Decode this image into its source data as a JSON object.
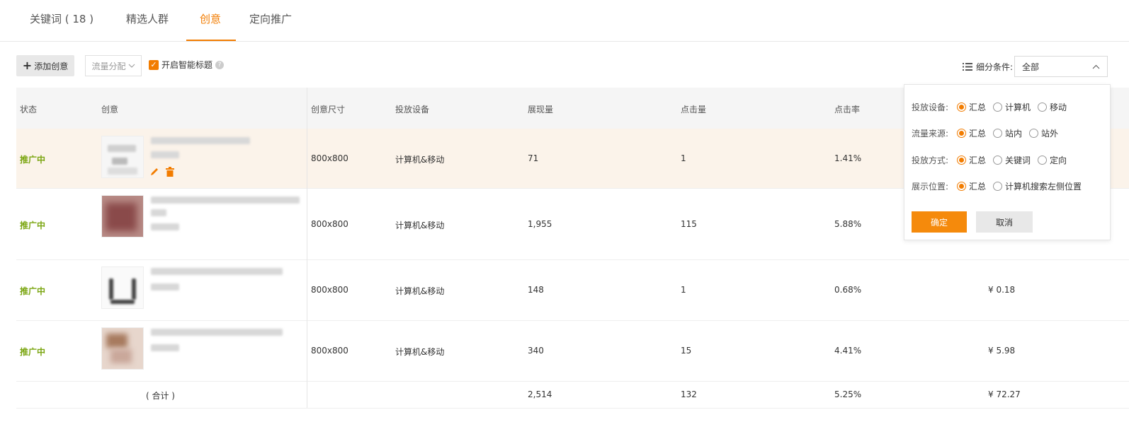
{
  "tabs": [
    {
      "label": "关键词 ( 18 )"
    },
    {
      "label": "精选人群"
    },
    {
      "label": "创意"
    },
    {
      "label": "定向推广"
    }
  ],
  "toolbar": {
    "add_label": "添加创意",
    "traffic_label": "流量分配",
    "smart_title_label": "开启智能标题",
    "filter_label": "细分条件:",
    "filter_value": "全部"
  },
  "table": {
    "headers": [
      "状态",
      "创意",
      "创意尺寸",
      "投放设备",
      "展现量",
      "点击量",
      "点击率"
    ],
    "rows": [
      {
        "status": "推广中",
        "size": "800x800",
        "device": "计算机&移动",
        "impressions": "71",
        "clicks": "1",
        "ctr": "1.41%",
        "cost": ""
      },
      {
        "status": "推广中",
        "size": "800x800",
        "device": "计算机&移动",
        "impressions": "1,955",
        "clicks": "115",
        "ctr": "5.88%",
        "cost": ""
      },
      {
        "status": "推广中",
        "size": "800x800",
        "device": "计算机&移动",
        "impressions": "148",
        "clicks": "1",
        "ctr": "0.68%",
        "cost": "¥ 0.18"
      },
      {
        "status": "推广中",
        "size": "800x800",
        "device": "计算机&移动",
        "impressions": "340",
        "clicks": "15",
        "ctr": "4.41%",
        "cost": "¥ 5.98"
      }
    ],
    "total": {
      "label": "( 合计 )",
      "impressions": "2,514",
      "clicks": "132",
      "ctr": "5.25%",
      "cost": "¥ 72.27"
    }
  },
  "popup": {
    "rows": [
      {
        "label": "投放设备:",
        "options": [
          "汇总",
          "计算机",
          "移动"
        ],
        "selected": 0
      },
      {
        "label": "流量来源:",
        "options": [
          "汇总",
          "站内",
          "站外"
        ],
        "selected": 0
      },
      {
        "label": "投放方式:",
        "options": [
          "汇总",
          "关键词",
          "定向"
        ],
        "selected": 0
      },
      {
        "label": "展示位置:",
        "options": [
          "汇总",
          "计算机搜索左侧位置"
        ],
        "selected": 0
      }
    ],
    "ok_label": "确定",
    "cancel_label": "取消"
  },
  "colors": {
    "accent": "#f27c00",
    "status": "#7aa510",
    "highlight": "#fbf3ea"
  }
}
